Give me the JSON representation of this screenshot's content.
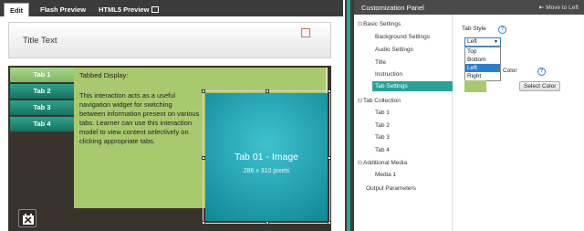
{
  "editor_tabs": [
    {
      "label": "Edit"
    },
    {
      "label": "Flash Preview"
    },
    {
      "label": "HTML5 Preview"
    }
  ],
  "stage": {
    "title": "Title Text",
    "tabs": [
      {
        "label": "Tab 1"
      },
      {
        "label": "Tab 2"
      },
      {
        "label": "Tab 3"
      },
      {
        "label": "Tab 4"
      }
    ],
    "heading": "Tabbed Display:",
    "description": "This interaction acts as a useful navigation widget for switching between information present on various tabs. Learner can use this interaction model to view content selectively on clicking appropriate tabs.",
    "image_title": "Tab 01 - Image",
    "image_size": "286 x 310 pixels"
  },
  "panel": {
    "title": "Customization Panel",
    "move_label": "Move to Left",
    "tree": [
      {
        "label": "Basic Settings",
        "toggle": "⊟"
      },
      {
        "label": "Background Settings"
      },
      {
        "label": "Audio Settings"
      },
      {
        "label": "Title"
      },
      {
        "label": "Instruction"
      },
      {
        "label": "Tab Settings"
      },
      {
        "label": "Tab Collection",
        "toggle": "⊟"
      },
      {
        "label": "Tab  1"
      },
      {
        "label": "Tab  2"
      },
      {
        "label": "Tab  3"
      },
      {
        "label": "Tab  4"
      },
      {
        "label": "Additional Media",
        "toggle": "⊟"
      },
      {
        "label": "Media  1"
      },
      {
        "label": "Output Parameters"
      }
    ],
    "tab_style_label": "Tab Style",
    "tab_style_value": "Left",
    "tab_style_options": [
      "Top",
      "Bottom",
      "Left",
      "Right"
    ],
    "color_label": "Color",
    "select_color_label": "Select Color",
    "help_glyph": "?"
  },
  "colors": {
    "accent": "#2aa198",
    "panel_green": "#a9c96e",
    "image_teal": "#1ea5b3",
    "stage_dark": "#3a332d"
  }
}
